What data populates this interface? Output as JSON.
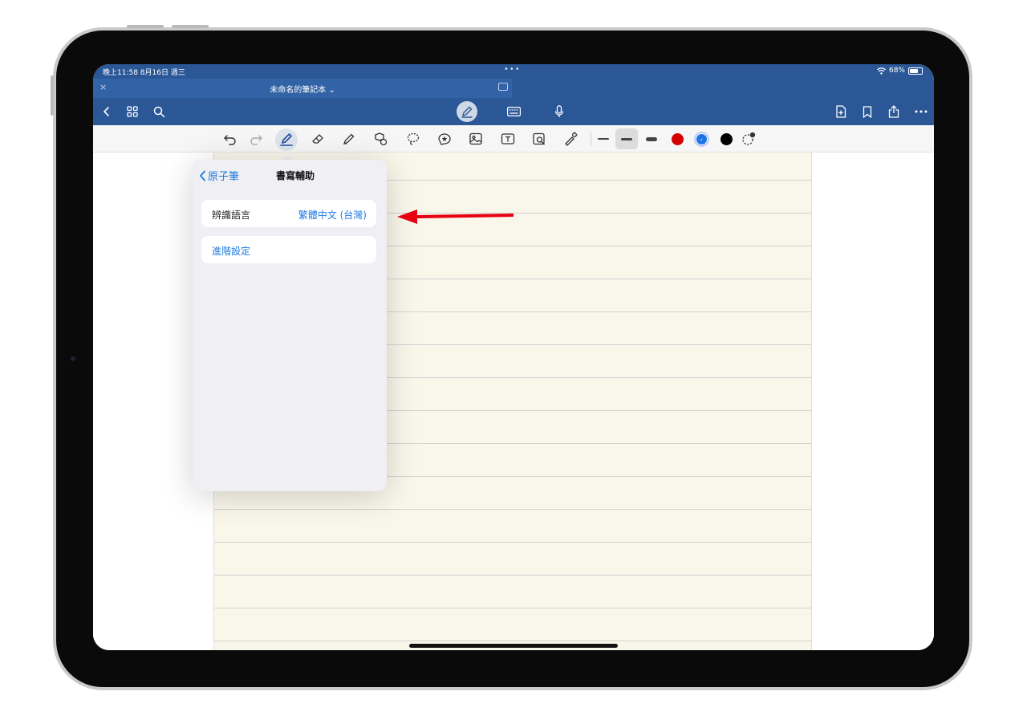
{
  "status": {
    "time_date": "晚上11:58  8月16日 週三",
    "battery": "68%"
  },
  "document": {
    "title": "未命名的筆記本 ⌄"
  },
  "colors": {
    "nav_blue": "#2b5797",
    "accent": "#1f7ae0",
    "red": "#d40000",
    "blue": "#1a73e8",
    "black": "#000000"
  },
  "nav": {
    "left_icons": [
      "chevron-left-icon",
      "grid-icon",
      "search-icon"
    ],
    "mode_icons": [
      "pencil-mode-icon",
      "keyboard-icon",
      "microphone-icon"
    ],
    "right_icons": [
      "add-page-icon",
      "bookmark-icon",
      "share-icon",
      "more-icon"
    ]
  },
  "toolbar": {
    "tools": [
      "undo-icon",
      "redo-icon",
      "pen-icon",
      "eraser-icon",
      "highlighter-icon",
      "shapes-icon",
      "lasso-icon",
      "sticker-icon",
      "image-icon",
      "text-icon",
      "camera-icon",
      "laser-icon"
    ],
    "stroke_sizes": [
      "thin",
      "medium",
      "thick"
    ],
    "pen_colors": [
      "red",
      "blue",
      "black"
    ]
  },
  "popover": {
    "back_label": "原子筆",
    "title": "書寫輔助",
    "recognition_label": "辨識語言",
    "recognition_value": "繁體中文 (台灣)",
    "advanced_label": "進階設定"
  }
}
